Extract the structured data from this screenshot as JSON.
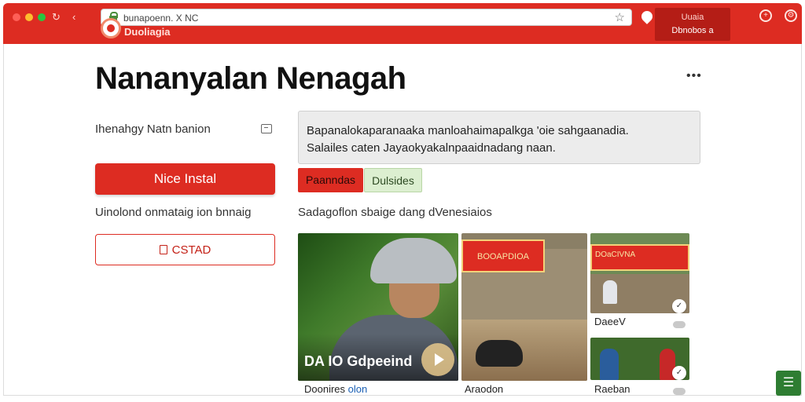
{
  "browser": {
    "url": "bunapoenn. X NC",
    "site_name": "Duoliagia",
    "promo_line1": "Uuaia",
    "promo_line2": "Dbnobos a"
  },
  "page": {
    "title": "Nananyalan Nenagah"
  },
  "left": {
    "label": "Ihenahgy Natn banion",
    "primary_button": "Nice Instal",
    "note": "Uinolond onmataig ion bnnaig",
    "outline_button": "CSTAD"
  },
  "right": {
    "description_line1": "Bapanalokaparanaaka manloahaimapalkga 'oie sahgaanadia.",
    "description_line2": "Salailes caten Jayaokyakalnpaaidnadang naan.",
    "tabs": [
      "Paanndas",
      "Dulsides"
    ],
    "section_label": "Sadagoflon sbaige dang dVenesiaios"
  },
  "media": {
    "main_title": "DA IO Gdpeeind",
    "main_caption_prefix": "Doonires",
    "main_caption_link": "olon",
    "mid_caption": "Araodon",
    "mid_banner": "BOOAPDIOA",
    "right1_caption": "DaeeV",
    "right1_sign": "DOaCIVNA",
    "right2_caption": "Raeban"
  },
  "colors": {
    "brand_red": "#dd2c22",
    "accent_green": "#2e7d32",
    "link_blue": "#1a5fb4"
  },
  "icons": [
    "reload-icon",
    "back-icon",
    "lock-icon",
    "star-icon",
    "extension-icon",
    "new-tab-icon",
    "settings-icon",
    "more-icon",
    "edit-icon",
    "bookmark-icon",
    "play-icon",
    "check-icon",
    "cloud-icon",
    "menu-icon"
  ]
}
